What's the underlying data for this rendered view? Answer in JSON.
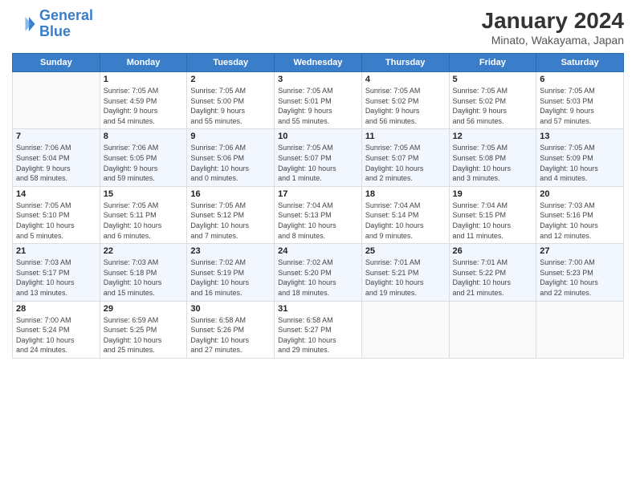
{
  "logo": {
    "line1": "General",
    "line2": "Blue"
  },
  "title": "January 2024",
  "subtitle": "Minato, Wakayama, Japan",
  "weekdays": [
    "Sunday",
    "Monday",
    "Tuesday",
    "Wednesday",
    "Thursday",
    "Friday",
    "Saturday"
  ],
  "weeks": [
    [
      {
        "day": "",
        "sunrise": "",
        "sunset": "",
        "daylight": ""
      },
      {
        "day": "1",
        "sunrise": "Sunrise: 7:05 AM",
        "sunset": "Sunset: 4:59 PM",
        "daylight": "Daylight: 9 hours and 54 minutes."
      },
      {
        "day": "2",
        "sunrise": "Sunrise: 7:05 AM",
        "sunset": "Sunset: 5:00 PM",
        "daylight": "Daylight: 9 hours and 55 minutes."
      },
      {
        "day": "3",
        "sunrise": "Sunrise: 7:05 AM",
        "sunset": "Sunset: 5:01 PM",
        "daylight": "Daylight: 9 hours and 55 minutes."
      },
      {
        "day": "4",
        "sunrise": "Sunrise: 7:05 AM",
        "sunset": "Sunset: 5:02 PM",
        "daylight": "Daylight: 9 hours and 56 minutes."
      },
      {
        "day": "5",
        "sunrise": "Sunrise: 7:05 AM",
        "sunset": "Sunset: 5:02 PM",
        "daylight": "Daylight: 9 hours and 56 minutes."
      },
      {
        "day": "6",
        "sunrise": "Sunrise: 7:05 AM",
        "sunset": "Sunset: 5:03 PM",
        "daylight": "Daylight: 9 hours and 57 minutes."
      }
    ],
    [
      {
        "day": "7",
        "sunrise": "Sunrise: 7:06 AM",
        "sunset": "Sunset: 5:04 PM",
        "daylight": "Daylight: 9 hours and 58 minutes."
      },
      {
        "day": "8",
        "sunrise": "Sunrise: 7:06 AM",
        "sunset": "Sunset: 5:05 PM",
        "daylight": "Daylight: 9 hours and 59 minutes."
      },
      {
        "day": "9",
        "sunrise": "Sunrise: 7:06 AM",
        "sunset": "Sunset: 5:06 PM",
        "daylight": "Daylight: 10 hours and 0 minutes."
      },
      {
        "day": "10",
        "sunrise": "Sunrise: 7:05 AM",
        "sunset": "Sunset: 5:07 PM",
        "daylight": "Daylight: 10 hours and 1 minute."
      },
      {
        "day": "11",
        "sunrise": "Sunrise: 7:05 AM",
        "sunset": "Sunset: 5:07 PM",
        "daylight": "Daylight: 10 hours and 2 minutes."
      },
      {
        "day": "12",
        "sunrise": "Sunrise: 7:05 AM",
        "sunset": "Sunset: 5:08 PM",
        "daylight": "Daylight: 10 hours and 3 minutes."
      },
      {
        "day": "13",
        "sunrise": "Sunrise: 7:05 AM",
        "sunset": "Sunset: 5:09 PM",
        "daylight": "Daylight: 10 hours and 4 minutes."
      }
    ],
    [
      {
        "day": "14",
        "sunrise": "Sunrise: 7:05 AM",
        "sunset": "Sunset: 5:10 PM",
        "daylight": "Daylight: 10 hours and 5 minutes."
      },
      {
        "day": "15",
        "sunrise": "Sunrise: 7:05 AM",
        "sunset": "Sunset: 5:11 PM",
        "daylight": "Daylight: 10 hours and 6 minutes."
      },
      {
        "day": "16",
        "sunrise": "Sunrise: 7:05 AM",
        "sunset": "Sunset: 5:12 PM",
        "daylight": "Daylight: 10 hours and 7 minutes."
      },
      {
        "day": "17",
        "sunrise": "Sunrise: 7:04 AM",
        "sunset": "Sunset: 5:13 PM",
        "daylight": "Daylight: 10 hours and 8 minutes."
      },
      {
        "day": "18",
        "sunrise": "Sunrise: 7:04 AM",
        "sunset": "Sunset: 5:14 PM",
        "daylight": "Daylight: 10 hours and 9 minutes."
      },
      {
        "day": "19",
        "sunrise": "Sunrise: 7:04 AM",
        "sunset": "Sunset: 5:15 PM",
        "daylight": "Daylight: 10 hours and 11 minutes."
      },
      {
        "day": "20",
        "sunrise": "Sunrise: 7:03 AM",
        "sunset": "Sunset: 5:16 PM",
        "daylight": "Daylight: 10 hours and 12 minutes."
      }
    ],
    [
      {
        "day": "21",
        "sunrise": "Sunrise: 7:03 AM",
        "sunset": "Sunset: 5:17 PM",
        "daylight": "Daylight: 10 hours and 13 minutes."
      },
      {
        "day": "22",
        "sunrise": "Sunrise: 7:03 AM",
        "sunset": "Sunset: 5:18 PM",
        "daylight": "Daylight: 10 hours and 15 minutes."
      },
      {
        "day": "23",
        "sunrise": "Sunrise: 7:02 AM",
        "sunset": "Sunset: 5:19 PM",
        "daylight": "Daylight: 10 hours and 16 minutes."
      },
      {
        "day": "24",
        "sunrise": "Sunrise: 7:02 AM",
        "sunset": "Sunset: 5:20 PM",
        "daylight": "Daylight: 10 hours and 18 minutes."
      },
      {
        "day": "25",
        "sunrise": "Sunrise: 7:01 AM",
        "sunset": "Sunset: 5:21 PM",
        "daylight": "Daylight: 10 hours and 19 minutes."
      },
      {
        "day": "26",
        "sunrise": "Sunrise: 7:01 AM",
        "sunset": "Sunset: 5:22 PM",
        "daylight": "Daylight: 10 hours and 21 minutes."
      },
      {
        "day": "27",
        "sunrise": "Sunrise: 7:00 AM",
        "sunset": "Sunset: 5:23 PM",
        "daylight": "Daylight: 10 hours and 22 minutes."
      }
    ],
    [
      {
        "day": "28",
        "sunrise": "Sunrise: 7:00 AM",
        "sunset": "Sunset: 5:24 PM",
        "daylight": "Daylight: 10 hours and 24 minutes."
      },
      {
        "day": "29",
        "sunrise": "Sunrise: 6:59 AM",
        "sunset": "Sunset: 5:25 PM",
        "daylight": "Daylight: 10 hours and 25 minutes."
      },
      {
        "day": "30",
        "sunrise": "Sunrise: 6:58 AM",
        "sunset": "Sunset: 5:26 PM",
        "daylight": "Daylight: 10 hours and 27 minutes."
      },
      {
        "day": "31",
        "sunrise": "Sunrise: 6:58 AM",
        "sunset": "Sunset: 5:27 PM",
        "daylight": "Daylight: 10 hours and 29 minutes."
      },
      {
        "day": "",
        "sunrise": "",
        "sunset": "",
        "daylight": ""
      },
      {
        "day": "",
        "sunrise": "",
        "sunset": "",
        "daylight": ""
      },
      {
        "day": "",
        "sunrise": "",
        "sunset": "",
        "daylight": ""
      }
    ]
  ]
}
